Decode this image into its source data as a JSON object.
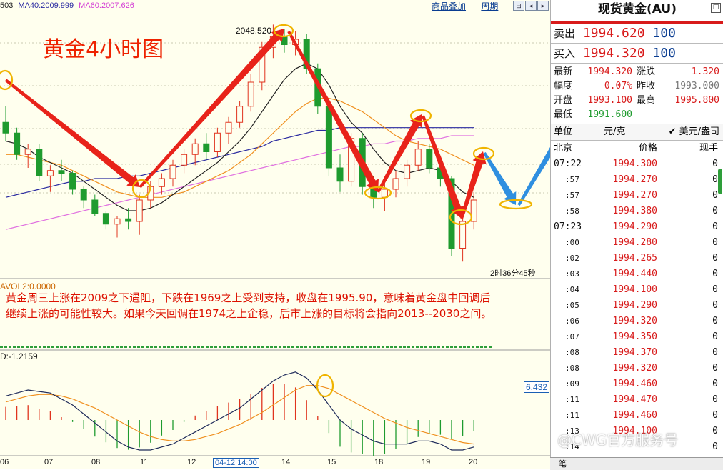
{
  "indicators": {
    "ma_fragment": "503",
    "ma40": "MA40:2009.999",
    "ma60": "MA60:2007.626"
  },
  "toolbar": {
    "overlay": "商品叠加",
    "period": "周期"
  },
  "chart_title": "黄金4小时图",
  "peak_label": "2048.520",
  "time_remaining": "2时36分45秒",
  "volume_label": "AVOL2:0.0000",
  "commentary": [
    "黄金周三上涨在2009之下遇阻，下跌在1969之上受到支持，收盘在1995.90，意味着黄金盘中回调后",
    "继续上涨的可能性较大。如果今天回调在1974之上企稳，后市上涨的目标将会指向2013--2030之间。"
  ],
  "macd_label": "D:-1.2159",
  "macd_value_box": "6.432",
  "x_ticks": [
    "06",
    "07",
    "08",
    "11",
    "12",
    "14",
    "15",
    "18",
    "19",
    "20"
  ],
  "x_tick_selected": "04-12 14:00",
  "panel": {
    "title": "现货黄金(AU)",
    "sell_label": "卖出",
    "sell_price": "1994.620",
    "sell_vol": "100",
    "buy_label": "买入",
    "buy_price": "1994.320",
    "buy_vol": "100",
    "stats": [
      {
        "k": "最新",
        "v": "1994.320",
        "k2": "涨跌",
        "v2": "1.320"
      },
      {
        "k": "幅度",
        "v": "0.07%",
        "k2": "昨收",
        "v2": "1993.000"
      },
      {
        "k": "开盘",
        "v": "1993.100",
        "k2": "最高",
        "v2": "1995.800"
      },
      {
        "k": "最低",
        "v": "1991.600",
        "k2": "",
        "v2": ""
      }
    ],
    "unit_label": "单位",
    "unit_value": "元/克",
    "unit_option": "✔ 美元/盎司",
    "table_headers": [
      "北京",
      "价格",
      "现手"
    ],
    "ticks": [
      {
        "t": "07:22",
        "p": "1994.300",
        "v": "0",
        "major": true
      },
      {
        "t": ":57",
        "p": "1994.270",
        "v": "0",
        "major": false
      },
      {
        "t": ":57",
        "p": "1994.270",
        "v": "0",
        "major": false
      },
      {
        "t": ":58",
        "p": "1994.380",
        "v": "0",
        "major": false
      },
      {
        "t": "07:23",
        "p": "1994.290",
        "v": "0",
        "major": true
      },
      {
        "t": ":00",
        "p": "1994.280",
        "v": "0",
        "major": false
      },
      {
        "t": ":02",
        "p": "1994.265",
        "v": "0",
        "major": false
      },
      {
        "t": ":03",
        "p": "1994.440",
        "v": "0",
        "major": false
      },
      {
        "t": ":04",
        "p": "1994.100",
        "v": "0",
        "major": false
      },
      {
        "t": ":05",
        "p": "1994.290",
        "v": "0",
        "major": false
      },
      {
        "t": ":06",
        "p": "1994.320",
        "v": "0",
        "major": false
      },
      {
        "t": ":07",
        "p": "1994.350",
        "v": "0",
        "major": false
      },
      {
        "t": ":08",
        "p": "1994.370",
        "v": "0",
        "major": false
      },
      {
        "t": ":08",
        "p": "1994.320",
        "v": "0",
        "major": false
      },
      {
        "t": ":09",
        "p": "1994.460",
        "v": "0",
        "major": false
      },
      {
        "t": ":11",
        "p": "1994.470",
        "v": "0",
        "major": false
      },
      {
        "t": ":11",
        "p": "1994.460",
        "v": "0",
        "major": false
      },
      {
        "t": ":13",
        "p": "1994.100",
        "v": "0",
        "major": false
      },
      {
        "t": ":14",
        "p": "",
        "v": "0",
        "major": false
      }
    ],
    "footer": "笔",
    "watermark": "@CWG官方服务号"
  },
  "colors": {
    "up": "#e0341e",
    "down": "#1e9b2e",
    "arrow_red": "#e8231a",
    "arrow_blue": "#2f8fe0",
    "circle": "#f0b400"
  },
  "chart_data": {
    "type": "candlestick",
    "candles": [
      {
        "o": 2012,
        "h": 2018,
        "l": 2005,
        "c": 2008
      },
      {
        "o": 2008,
        "h": 2010,
        "l": 1998,
        "c": 2000
      },
      {
        "o": 2000,
        "h": 2004,
        "l": 1995,
        "c": 2002
      },
      {
        "o": 2002,
        "h": 2004,
        "l": 1990,
        "c": 1992
      },
      {
        "o": 1992,
        "h": 1996,
        "l": 1986,
        "c": 1994
      },
      {
        "o": 1994,
        "h": 1998,
        "l": 1990,
        "c": 1993
      },
      {
        "o": 1993,
        "h": 1994,
        "l": 1985,
        "c": 1987
      },
      {
        "o": 1987,
        "h": 1988,
        "l": 1980,
        "c": 1983
      },
      {
        "o": 1983,
        "h": 1985,
        "l": 1977,
        "c": 1978
      },
      {
        "o": 1978,
        "h": 1979,
        "l": 1972,
        "c": 1974
      },
      {
        "o": 1974,
        "h": 1977,
        "l": 1969,
        "c": 1976
      },
      {
        "o": 1976,
        "h": 1980,
        "l": 1972,
        "c": 1975
      },
      {
        "o": 1975,
        "h": 1985,
        "l": 1970,
        "c": 1983
      },
      {
        "o": 1983,
        "h": 1990,
        "l": 1980,
        "c": 1988
      },
      {
        "o": 1988,
        "h": 1993,
        "l": 1985,
        "c": 1991
      },
      {
        "o": 1991,
        "h": 1998,
        "l": 1988,
        "c": 1996
      },
      {
        "o": 1996,
        "h": 2002,
        "l": 1993,
        "c": 2000
      },
      {
        "o": 2000,
        "h": 2006,
        "l": 1996,
        "c": 2004
      },
      {
        "o": 2004,
        "h": 2008,
        "l": 1998,
        "c": 2001
      },
      {
        "o": 2001,
        "h": 2010,
        "l": 1999,
        "c": 2008
      },
      {
        "o": 2008,
        "h": 2014,
        "l": 2004,
        "c": 2012
      },
      {
        "o": 2012,
        "h": 2020,
        "l": 2010,
        "c": 2018
      },
      {
        "o": 2018,
        "h": 2030,
        "l": 2016,
        "c": 2027
      },
      {
        "o": 2027,
        "h": 2042,
        "l": 2024,
        "c": 2040
      },
      {
        "o": 2040,
        "h": 2048.5,
        "l": 2036,
        "c": 2044
      },
      {
        "o": 2044,
        "h": 2047,
        "l": 2038,
        "c": 2041
      },
      {
        "o": 2041,
        "h": 2046,
        "l": 2037,
        "c": 2043
      },
      {
        "o": 2043,
        "h": 2045,
        "l": 2030,
        "c": 2032
      },
      {
        "o": 2032,
        "h": 2034,
        "l": 2015,
        "c": 2018
      },
      {
        "o": 2018,
        "h": 2020,
        "l": 1992,
        "c": 1995
      },
      {
        "o": 1995,
        "h": 2000,
        "l": 1986,
        "c": 1990
      },
      {
        "o": 1990,
        "h": 2008,
        "l": 1988,
        "c": 2006
      },
      {
        "o": 2006,
        "h": 2008,
        "l": 1985,
        "c": 1988
      },
      {
        "o": 1988,
        "h": 1992,
        "l": 1980,
        "c": 1984
      },
      {
        "o": 1984,
        "h": 1990,
        "l": 1979,
        "c": 1987
      },
      {
        "o": 1987,
        "h": 1994,
        "l": 1984,
        "c": 1991
      },
      {
        "o": 1991,
        "h": 1998,
        "l": 1988,
        "c": 1996
      },
      {
        "o": 1996,
        "h": 2005,
        "l": 1994,
        "c": 2002
      },
      {
        "o": 2002,
        "h": 2004,
        "l": 1993,
        "c": 1995
      },
      {
        "o": 1995,
        "h": 1997,
        "l": 1988,
        "c": 1991
      },
      {
        "o": 1991,
        "h": 1992,
        "l": 1962,
        "c": 1965
      },
      {
        "o": 1965,
        "h": 1978,
        "l": 1960,
        "c": 1975
      },
      {
        "o": 1975,
        "h": 1986,
        "l": 1972,
        "c": 1983
      }
    ],
    "ma_fast": [
      2005,
      2004,
      2002,
      1999,
      1997,
      1995,
      1993,
      1990,
      1987,
      1984,
      1981,
      1979,
      1979,
      1980,
      1982,
      1985,
      1988,
      1991,
      1994,
      1997,
      2001,
      2005,
      2010,
      2016,
      2022,
      2028,
      2032,
      2034,
      2032,
      2026,
      2018,
      2012,
      2008,
      2002,
      1997,
      1994,
      1993,
      1994,
      1995,
      1994,
      1990,
      1986,
      1984
    ],
    "ma_mid": [
      2000,
      2000,
      1999,
      1998,
      1997,
      1996,
      1994,
      1992,
      1990,
      1988,
      1986,
      1985,
      1984,
      1984,
      1984,
      1985,
      1986,
      1988,
      1990,
      1992,
      1994,
      1997,
      2000,
      2004,
      2008,
      2012,
      2016,
      2019,
      2021,
      2021,
      2020,
      2018,
      2016,
      2013,
      2010,
      2007,
      2005,
      2004,
      2003,
      2002,
      2000,
      1998,
      1996
    ],
    "ma40": [
      1984,
      1985,
      1986,
      1987,
      1988,
      1989,
      1990,
      1990,
      1991,
      1991,
      1991,
      1992,
      1992,
      1993,
      1994,
      1995,
      1996,
      1997,
      1998,
      1999,
      2000,
      2001,
      2002,
      2003,
      2005,
      2006,
      2007,
      2008,
      2009,
      2009,
      2010,
      2010,
      2010,
      2010,
      2010,
      2010,
      2010,
      2010,
      2010,
      2010,
      2010,
      2010,
      2010
    ],
    "ma60": [
      1972,
      1973,
      1974,
      1975,
      1976,
      1977,
      1978,
      1979,
      1980,
      1981,
      1982,
      1983,
      1984,
      1985,
      1986,
      1987,
      1988,
      1989,
      1990,
      1991,
      1992,
      1993,
      1994,
      1995,
      1996,
      1997,
      1998,
      1999,
      2000,
      2001,
      2002,
      2003,
      2003,
      2004,
      2004,
      2005,
      2005,
      2006,
      2006,
      2006,
      2007,
      2007,
      2007
    ],
    "macd_dif": [
      8,
      9,
      10,
      9.5,
      9,
      7,
      5,
      2,
      -1,
      -4,
      -7,
      -9,
      -10,
      -10,
      -9,
      -8,
      -6,
      -4,
      -2,
      0,
      2,
      4,
      7,
      10,
      13,
      15,
      16,
      14,
      10,
      5,
      0,
      -3,
      -5,
      -7,
      -8,
      -8,
      -8,
      -7,
      -7,
      -8,
      -10,
      -10,
      -9
    ],
    "macd_dea": [
      6,
      7,
      8,
      8.5,
      8.5,
      8,
      7,
      5.5,
      4,
      2,
      0,
      -2,
      -4,
      -5.5,
      -6.5,
      -7,
      -7,
      -6.5,
      -5.5,
      -4.5,
      -3,
      -1.5,
      0.5,
      2.5,
      5,
      7.5,
      10,
      11.5,
      11.5,
      10.5,
      8.5,
      6.5,
      4.5,
      2.5,
      0.5,
      -1,
      -2.5,
      -3.5,
      -4.5,
      -5.5,
      -6.5,
      -7.5,
      -8
    ],
    "ylim": [
      1955,
      2055
    ]
  }
}
